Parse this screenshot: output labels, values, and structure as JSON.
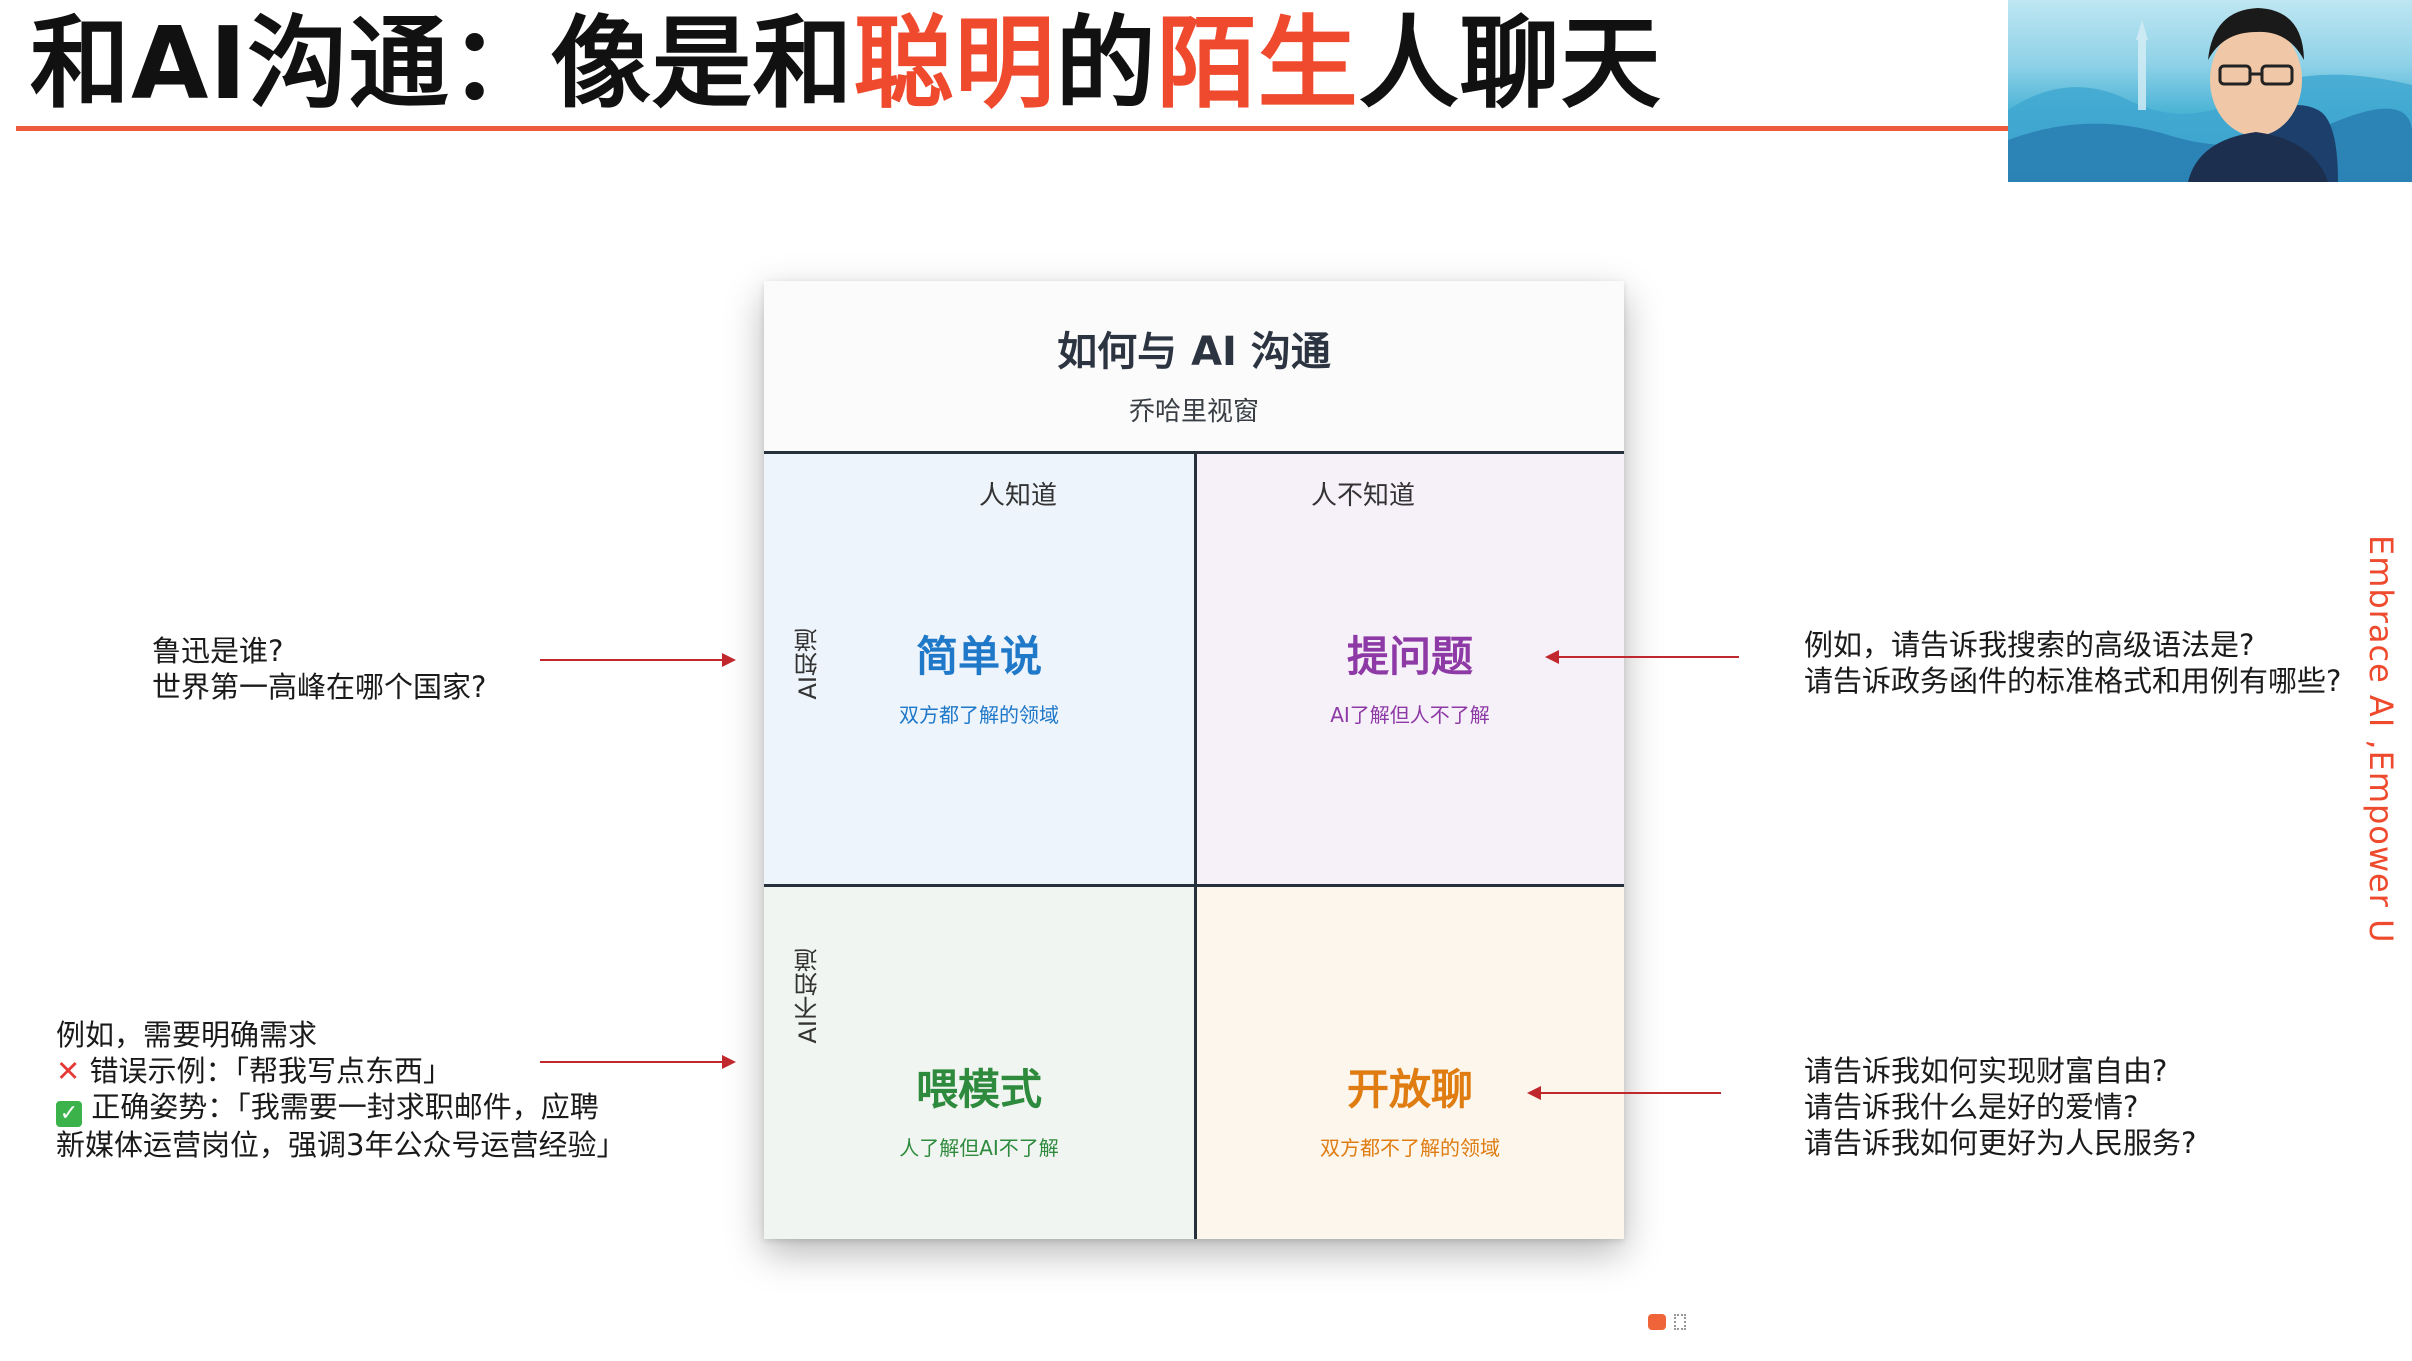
{
  "header": {
    "title_part1": "和AI沟通：像是和",
    "title_hl1": "聪明",
    "title_part2": "的",
    "title_hl2": "陌生",
    "title_part3": "人聊天"
  },
  "matrix": {
    "title": "如何与 AI 沟通",
    "subtitle": "乔哈里视窗",
    "col_known": "人知道",
    "col_unknown": "人不知道",
    "row_known": "AI知道",
    "row_unknown": "AI不知道",
    "quadrants": {
      "tl": {
        "title": "简单说",
        "desc": "双方都了解的领域",
        "color": "#1f78c8"
      },
      "tr": {
        "title": "提问题",
        "desc": "AI了解但人不了解",
        "color": "#8e3aa6"
      },
      "bl": {
        "title": "喂模式",
        "desc": "人了解但AI不了解",
        "color": "#2e8b3d"
      },
      "br": {
        "title": "开放聊",
        "desc": "双方都不了解的领域",
        "color": "#e07d12"
      }
    }
  },
  "notes": {
    "left_top": [
      "鲁迅是谁?",
      "世界第一高峰在哪个国家?"
    ],
    "left_bottom": {
      "intro": "例如，需要明确需求",
      "wrong_label": "错误示例：「帮我写点东西」",
      "right_label": "正确姿势：「我需要一封求职邮件，应聘",
      "right_cont": "新媒体运营岗位，强调3年公众号运营经验」"
    },
    "right_top": [
      "例如，请告诉我搜索的高级语法是?",
      "请告诉政务函件的标准格式和用例有哪些?"
    ],
    "right_bottom": [
      "请告诉我如何实现财富自由?",
      "请告诉我什么是好的爱情?",
      "请告诉我如何更好为人民服务?"
    ]
  },
  "side_text": "Embrace AI ,Empower U",
  "colors": {
    "accent": "#ef4a2e",
    "arrow": "#c0282d"
  }
}
